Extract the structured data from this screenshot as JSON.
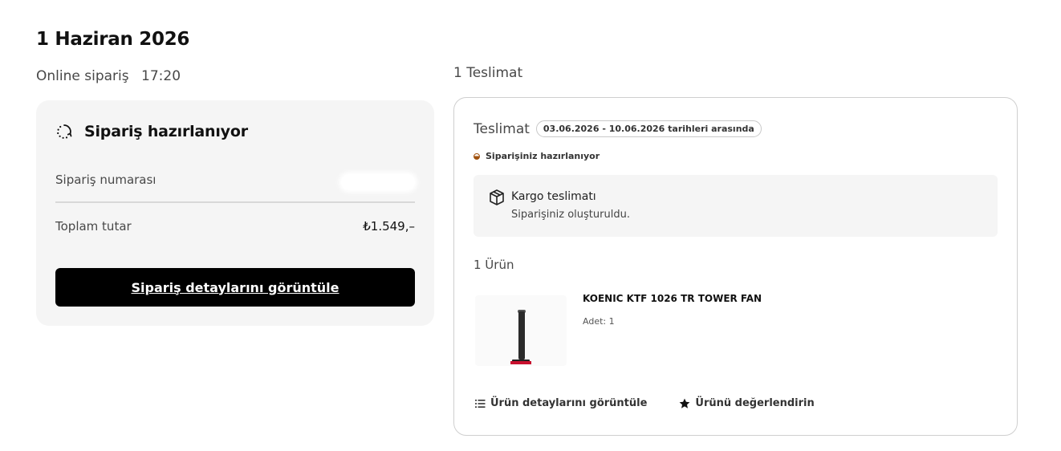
{
  "order": {
    "date_title": "1 Haziran 2026",
    "type": "Online sipariş",
    "time": "17:20"
  },
  "status_card": {
    "icon": "loading-spinner-icon",
    "title": "Sipariş hazırlanıyor",
    "order_number_label": "Sipariş numarası",
    "total_label": "Toplam tutar",
    "total_value": "₺1.549,–",
    "details_button": "Sipariş detaylarını görüntüle"
  },
  "delivery": {
    "count_label": "1 Teslimat",
    "label": "Teslimat",
    "date_range": "03.06.2026 - 10.06.2026 tarihleri arasında",
    "status_text": "Siparişiniz hazırlanıyor",
    "status_color": "#a0520f",
    "cargo": {
      "icon": "package-box-icon",
      "title": "Kargo teslimatı",
      "subtitle": "Siparişiniz oluşturuldu."
    },
    "product_count": "1 Ürün",
    "product": {
      "name": "KOENIC KTF 1026 TR TOWER FAN",
      "qty": "Adet: 1",
      "image_icon": "tower-fan-image"
    },
    "actions": {
      "details": "Ürün detaylarını görüntüle",
      "details_icon": "list-icon",
      "review": "Ürünü değerlendirin",
      "review_icon": "star-icon"
    }
  }
}
